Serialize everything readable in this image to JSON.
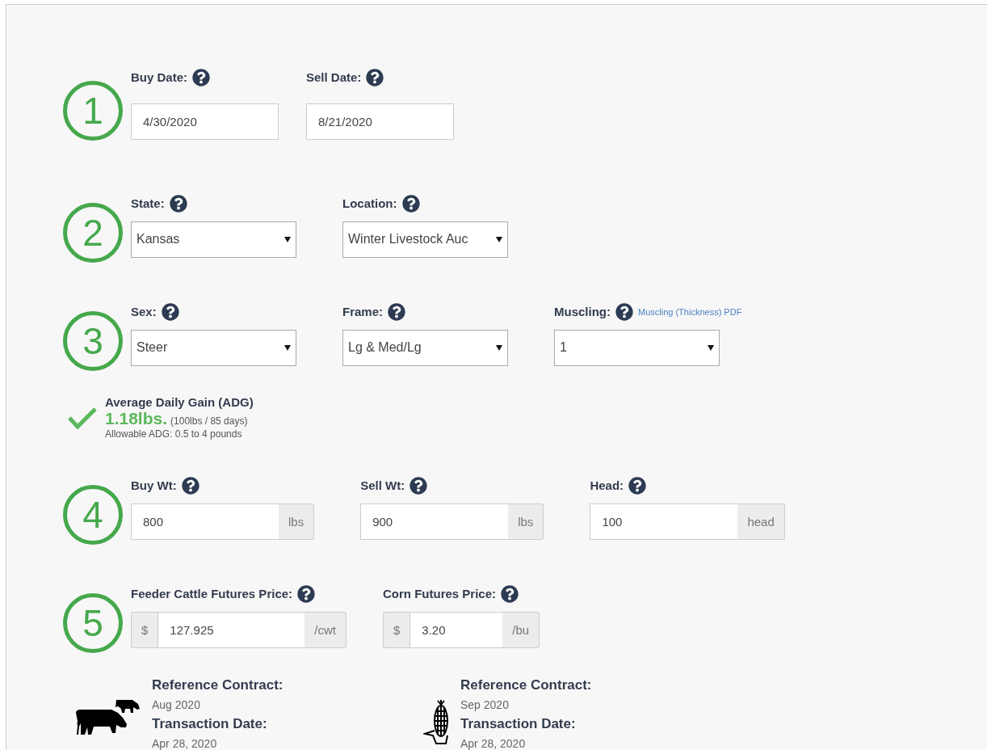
{
  "steps": [
    {
      "number": "1",
      "fields": [
        {
          "kind": "text",
          "label": "Buy Date:",
          "value": "4/30/2020"
        },
        {
          "kind": "text",
          "label": "Sell Date:",
          "value": "8/21/2020"
        }
      ]
    },
    {
      "number": "2",
      "fields": [
        {
          "kind": "select",
          "label": "State:",
          "value": "Kansas"
        },
        {
          "kind": "select",
          "label": "Location:",
          "value": "Winter Livestock Auc"
        }
      ]
    },
    {
      "number": "3",
      "fields": [
        {
          "kind": "select",
          "label": "Sex:",
          "value": "Steer"
        },
        {
          "kind": "select",
          "label": "Frame:",
          "value": "Lg & Med/Lg"
        },
        {
          "kind": "select",
          "label": "Muscling:",
          "value": "1",
          "link": "Muscling (Thickness) PDF"
        }
      ]
    },
    {
      "kind": "adg",
      "title": "Average Daily Gain (ADG)",
      "ok": true,
      "value": "1.18lbs.",
      "detail": "(100lbs / 85 days)",
      "note": "Allowable ADG: 0.5 to 4 pounds"
    },
    {
      "number": "4",
      "fields": [
        {
          "kind": "suffix",
          "label": "Buy Wt:",
          "value": "800",
          "suffix": "lbs"
        },
        {
          "kind": "suffix",
          "label": "Sell Wt:",
          "value": "900",
          "suffix": "lbs"
        },
        {
          "kind": "suffix",
          "label": "Head:",
          "value": "100",
          "suffix": "head"
        }
      ]
    },
    {
      "number": "5",
      "fields": [
        {
          "kind": "both",
          "label": "Feeder Cattle Futures Price:",
          "prefix": "$",
          "value": "127.925",
          "suffix": "/cwt"
        },
        {
          "kind": "both",
          "label": "Corn Futures Price:",
          "prefix": "$",
          "value": "3.20",
          "suffix": "/bu"
        }
      ]
    }
  ],
  "references": [
    {
      "kind": "cattle",
      "contract_label": "Reference Contract:",
      "contract": "Aug 2020",
      "date_label": "Transaction Date:",
      "date": "Apr 28, 2020"
    },
    {
      "kind": "corn",
      "contract_label": "Reference Contract:",
      "contract": "Sep 2020",
      "date_label": "Transaction Date:",
      "date": "Apr 28, 2020"
    }
  ]
}
